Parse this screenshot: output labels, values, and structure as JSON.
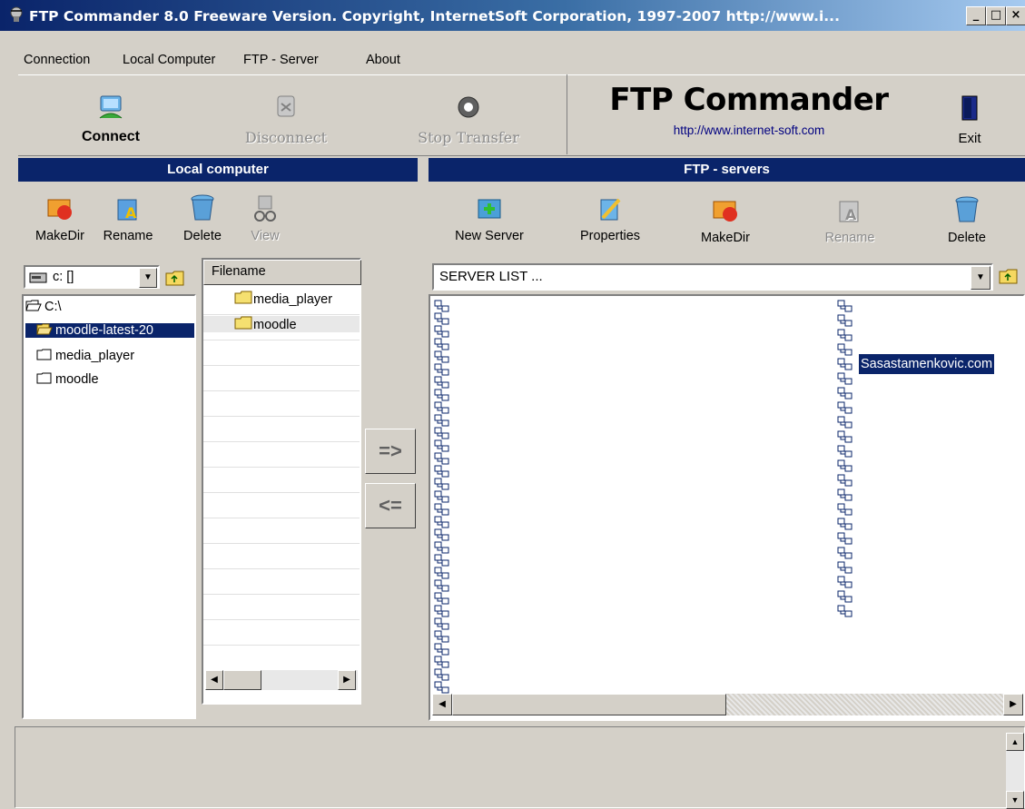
{
  "window": {
    "title": "FTP Commander 8.0  Freeware Version.  Copyright,  InternetSoft Corporation, 1997-2007   http://www.i...",
    "minimize_label": "_",
    "maximize_label": "□",
    "close_label": "×"
  },
  "menu": [
    "Connection",
    "Local Computer",
    "FTP - Server",
    "About"
  ],
  "toolbar": {
    "connect": "Connect",
    "disconnect": "Disconnect",
    "stop_transfer": "Stop Transfer",
    "exit": "Exit"
  },
  "brand": {
    "title": "FTP Commander",
    "url": "http://www.internet-soft.com"
  },
  "local": {
    "header": "Local computer",
    "buttons": {
      "makedir": "MakeDir",
      "rename": "Rename",
      "delete": "Delete",
      "view": "View"
    },
    "drive": "c: []",
    "tree": [
      "C:\\",
      "moodle-latest-20",
      "media_player",
      "moodle"
    ],
    "files_header": "Filename",
    "files": [
      "media_player",
      "moodle"
    ]
  },
  "transfer": {
    "upload": "=>",
    "download": "<="
  },
  "ftp": {
    "header": "FTP - servers",
    "buttons": {
      "new_server": "New Server",
      "properties": "Properties",
      "makedir": "MakeDir",
      "rename": "Rename",
      "delete": "Delete"
    },
    "server_list": "SERVER LIST ...",
    "selected_server": "Sasastamenkovic.com"
  },
  "colors": {
    "titlebar": "#0a246a",
    "panel_header": "#0a246a",
    "selection": "#0a246a",
    "face": "#d4d0c8"
  }
}
